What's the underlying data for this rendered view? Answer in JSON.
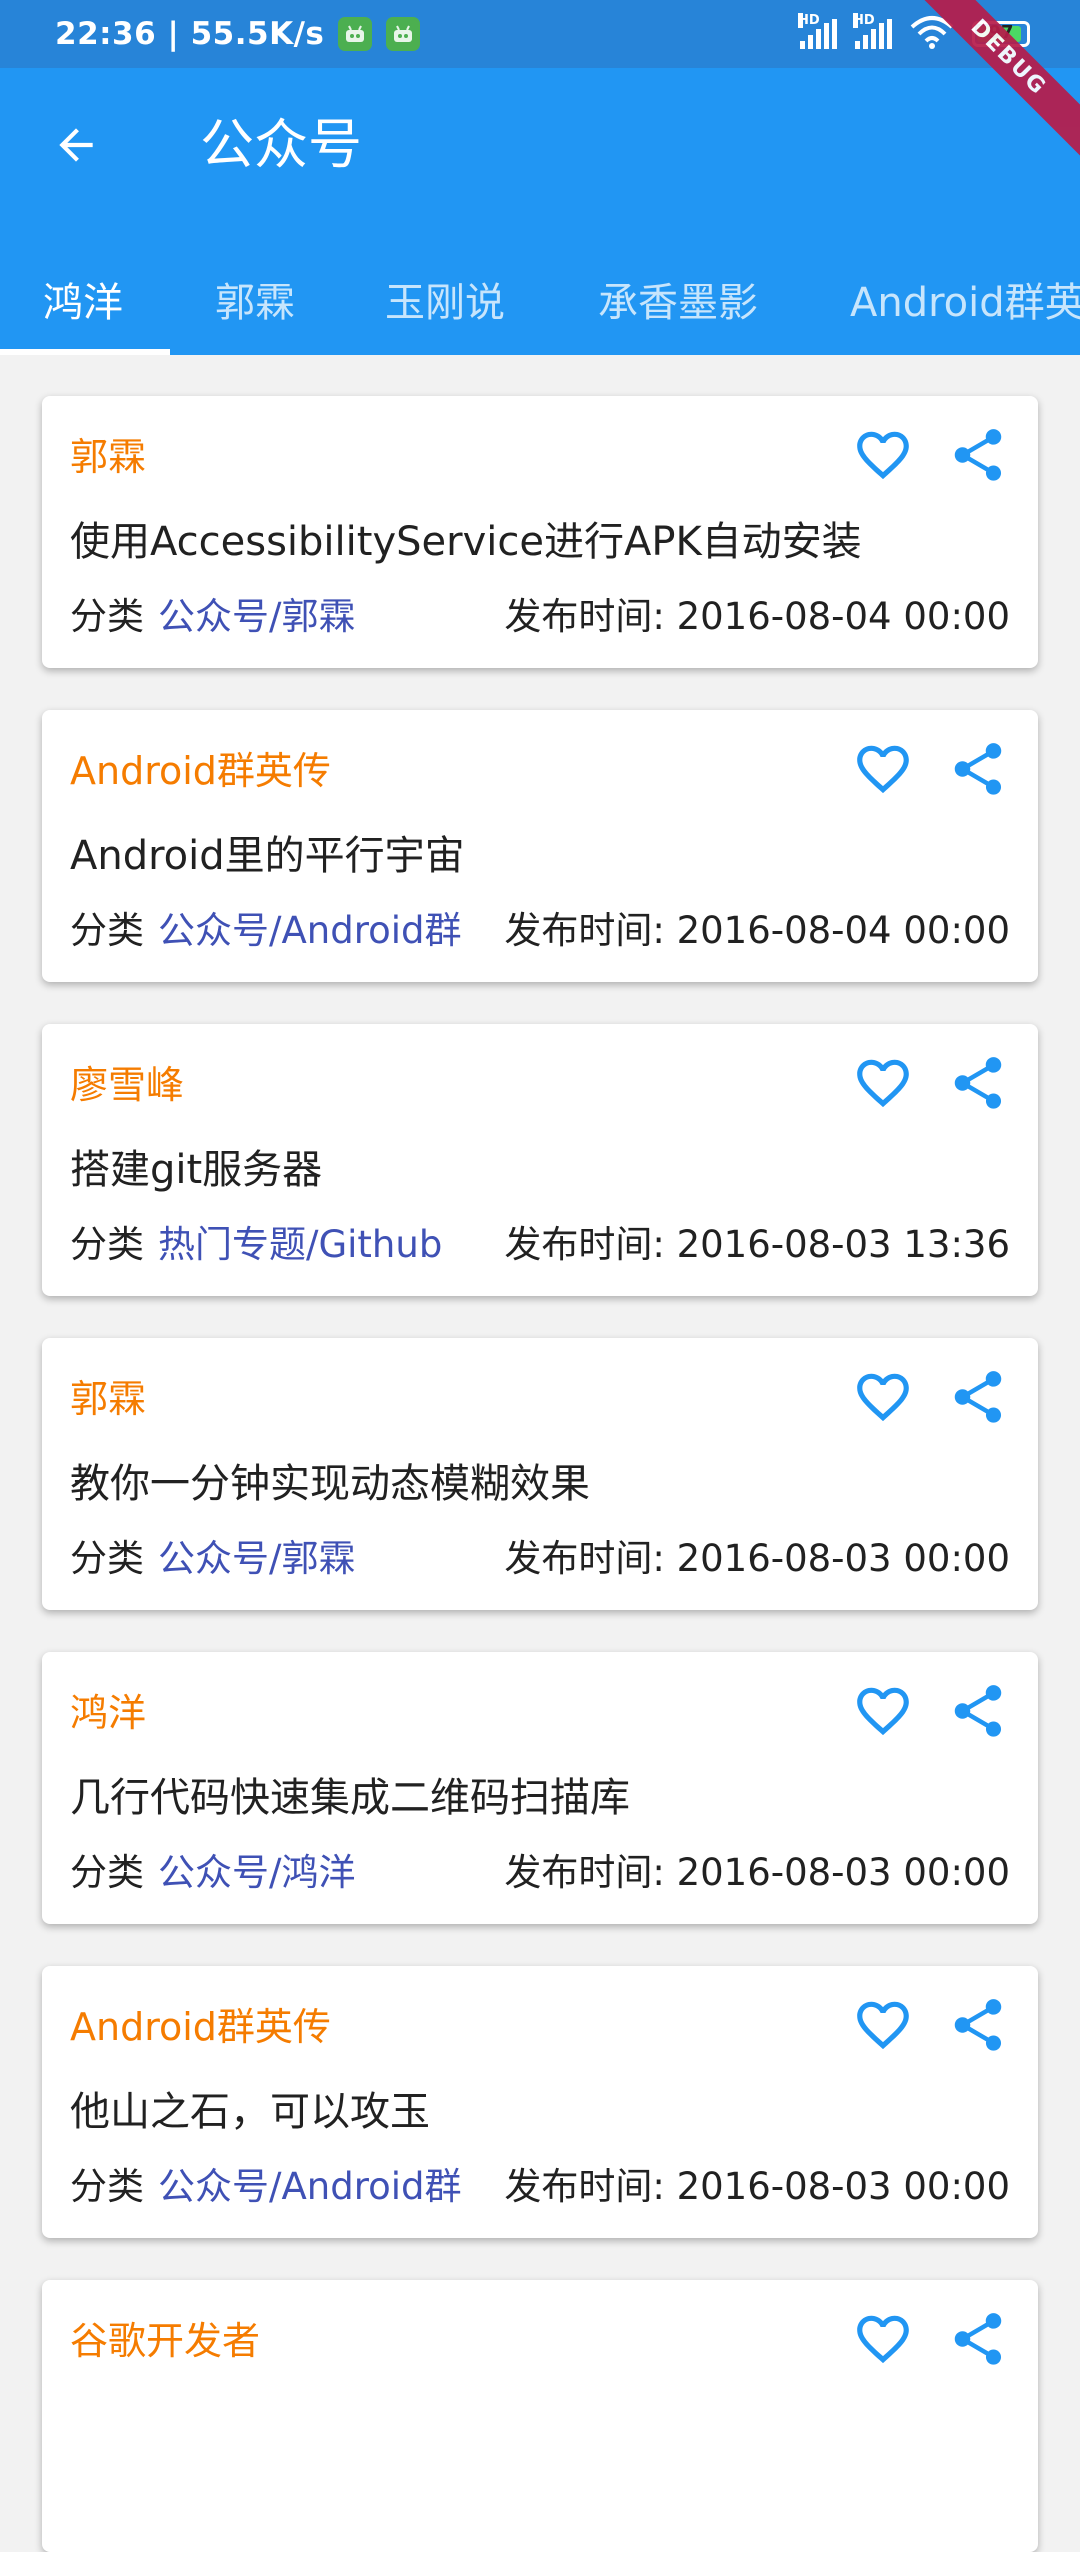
{
  "status_bar": {
    "time_speed": "22:36 | 55.5K/s",
    "network_label_1": "HD",
    "network_label_2": "HD",
    "battery": "97"
  },
  "debug_banner": "DEBUG",
  "app_bar": {
    "title": "公众号",
    "back_icon": "arrow-back-icon"
  },
  "tabs": [
    {
      "label": "鸿洋",
      "selected": true
    },
    {
      "label": "郭霖",
      "selected": false
    },
    {
      "label": "玉刚说",
      "selected": false
    },
    {
      "label": "承香墨影",
      "selected": false
    },
    {
      "label": "Android群英传",
      "selected": false
    }
  ],
  "colors": {
    "app_bar": "#2196f3",
    "author": "#f57c00",
    "category": "#3f51b5",
    "icon": "#2196f3"
  },
  "articles": [
    {
      "author": "郭霖",
      "title": "使用AccessibilityService进行APK自动安装",
      "category_label": "分类",
      "category": "公众号/郭霖",
      "date": "发布时间: 2016-08-04 00:00"
    },
    {
      "author": "Android群英传",
      "title": "Android里的平行宇宙",
      "category_label": "分类",
      "category": "公众号/Android群",
      "date": "发布时间: 2016-08-04 00:00"
    },
    {
      "author": "廖雪峰",
      "title": "搭建git服务器",
      "category_label": "分类",
      "category": "热门专题/Github",
      "date": "发布时间: 2016-08-03 13:36"
    },
    {
      "author": "郭霖",
      "title": "教你一分钟实现动态模糊效果",
      "category_label": "分类",
      "category": "公众号/郭霖",
      "date": "发布时间: 2016-08-03 00:00"
    },
    {
      "author": "鸿洋",
      "title": "几行代码快速集成二维码扫描库",
      "category_label": "分类",
      "category": "公众号/鸿洋",
      "date": "发布时间: 2016-08-03 00:00"
    },
    {
      "author": "Android群英传",
      "title": "他山之石，可以攻玉",
      "category_label": "分类",
      "category": "公众号/Android群",
      "date": "发布时间: 2016-08-03 00:00"
    },
    {
      "author": "谷歌开发者",
      "title": "",
      "category_label": "",
      "category": "",
      "date": ""
    }
  ],
  "card_icons": {
    "favorite": "heart-outline-icon",
    "share": "share-icon"
  }
}
